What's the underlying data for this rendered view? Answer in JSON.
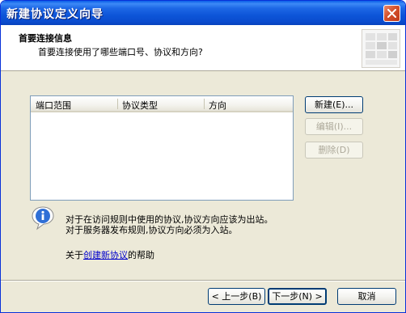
{
  "window": {
    "title": "新建协议定义向导"
  },
  "header": {
    "title": "首要连接信息",
    "subtitle": "首要连接使用了哪些端口号、协议和方向?"
  },
  "listview": {
    "columns": [
      "端口范围",
      "协议类型",
      "方向"
    ],
    "rows": []
  },
  "side_buttons": {
    "new_label": "新建(E)...",
    "edit_label": "编辑(I)...",
    "delete_label": "删除(D)"
  },
  "info": {
    "line1": "对于在访问规则中使用的协议,协议方向应该为出站。",
    "line2": "对于服务器发布规则,协议方向必须为入站。",
    "help_prefix": "关于",
    "help_link": "创建新协议",
    "help_suffix": "的帮助"
  },
  "footer": {
    "back_label": "< 上一步(B)",
    "next_label": "下一步(N) >",
    "cancel_label": "取消"
  },
  "colors": {
    "titlebar": "#0a55d8",
    "dialog_bg": "#ece9d8",
    "button_border": "#003c74",
    "link": "#0000cc"
  },
  "icons": {
    "close": "close-icon",
    "info": "info-icon",
    "wizard": "wizard-graphic-icon"
  }
}
